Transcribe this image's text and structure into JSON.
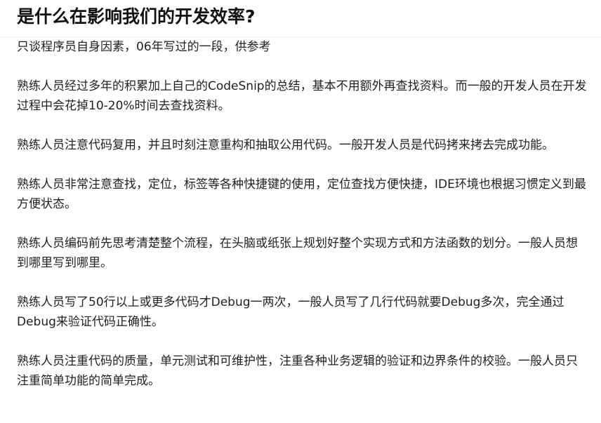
{
  "article": {
    "title": "是什么在影响我们的开发效率?",
    "intro": "只谈程序员自身因素，06年写过的一段，供参考",
    "paragraphs": [
      "熟练人员经过多年的积累加上自己的CodeSnip的总结，基本不用额外再查找资料。而一般的开发人员在开发过程中会花掉10-20%时间去查找资料。",
      "熟练人员注意代码复用，并且时刻注意重构和抽取公用代码。一般开发人员是代码拷来拷去完成功能。",
      "熟练人员非常注意查找，定位，标签等各种快捷键的使用，定位查找方便快捷，IDE环境也根据习惯定义到最方便状态。",
      "熟练人员编码前先思考清楚整个流程，在头脑或纸张上规划好整个实现方式和方法函数的划分。一般人员想到哪里写到哪里。",
      "熟练人员写了50行以上或更多代码才Debug一两次，一般人员写了几行代码就要Debug多次，完全通过Debug来验证代码正确性。",
      "熟练人员注重代码的质量，单元测试和可维护性，注重各种业务逻辑的验证和边界条件的校验。一般人员只注重简单功能的简单完成。"
    ]
  }
}
